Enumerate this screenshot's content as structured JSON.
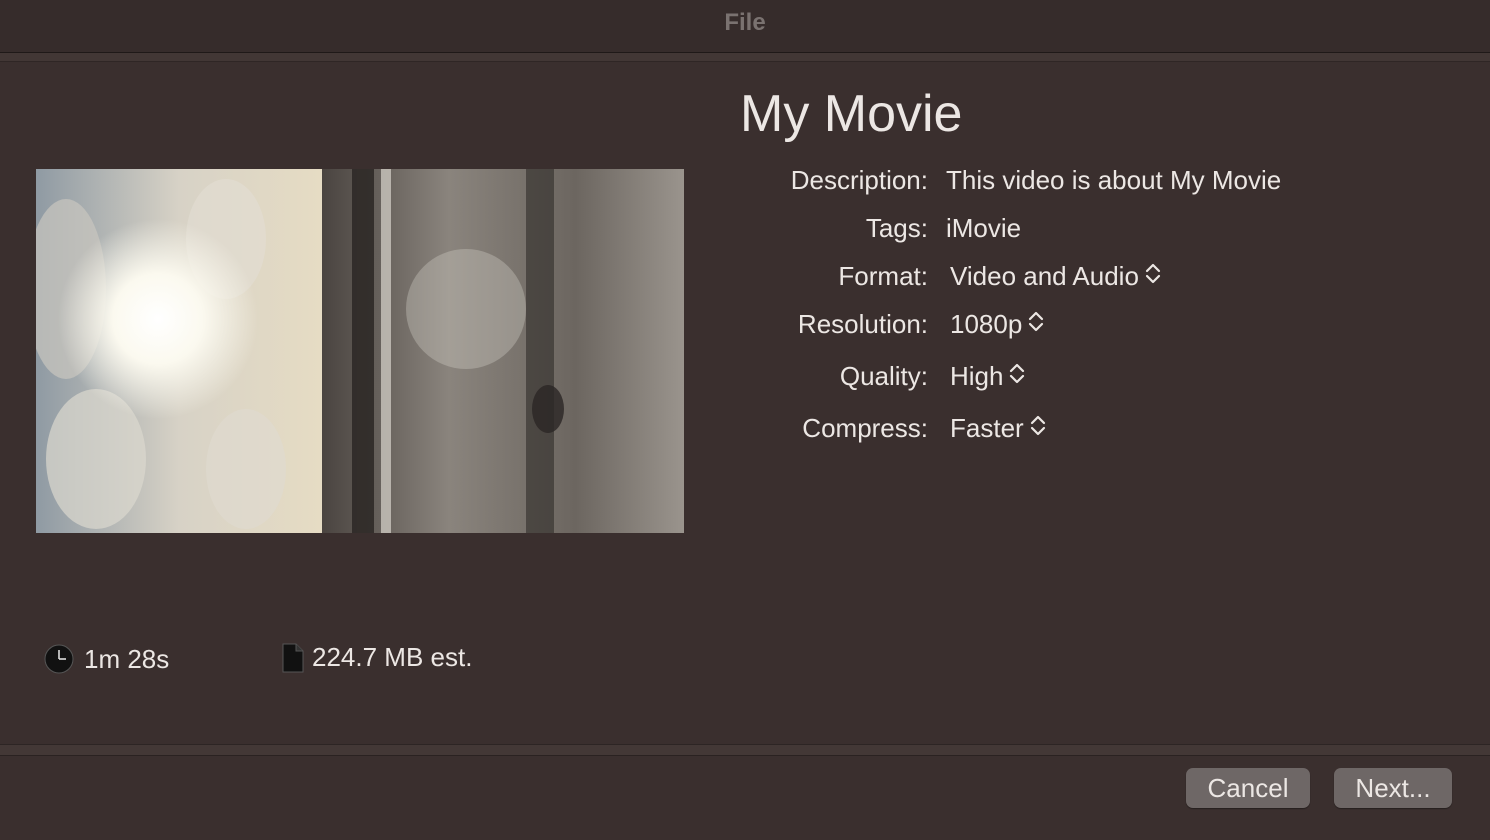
{
  "window": {
    "title": "File"
  },
  "movie": {
    "title": "My Movie"
  },
  "fields": {
    "description": {
      "label": "Description:",
      "value": "This video is about My Movie"
    },
    "tags": {
      "label": "Tags:",
      "value": "iMovie"
    },
    "format": {
      "label": "Format:",
      "value": "Video and Audio"
    },
    "resolution": {
      "label": "Resolution:",
      "value": "1080p"
    },
    "quality": {
      "label": "Quality:",
      "value": "High"
    },
    "compress": {
      "label": "Compress:",
      "value": "Faster"
    }
  },
  "stats": {
    "duration": {
      "icon": "clock-icon",
      "value": "1m 28s"
    },
    "size": {
      "icon": "document-icon",
      "value": "224.7 MB est."
    }
  },
  "buttons": {
    "cancel": "Cancel",
    "next": "Next..."
  },
  "colors": {
    "background": "#3a2f2e",
    "button": "#6e6766",
    "text": "#ece7e4"
  }
}
